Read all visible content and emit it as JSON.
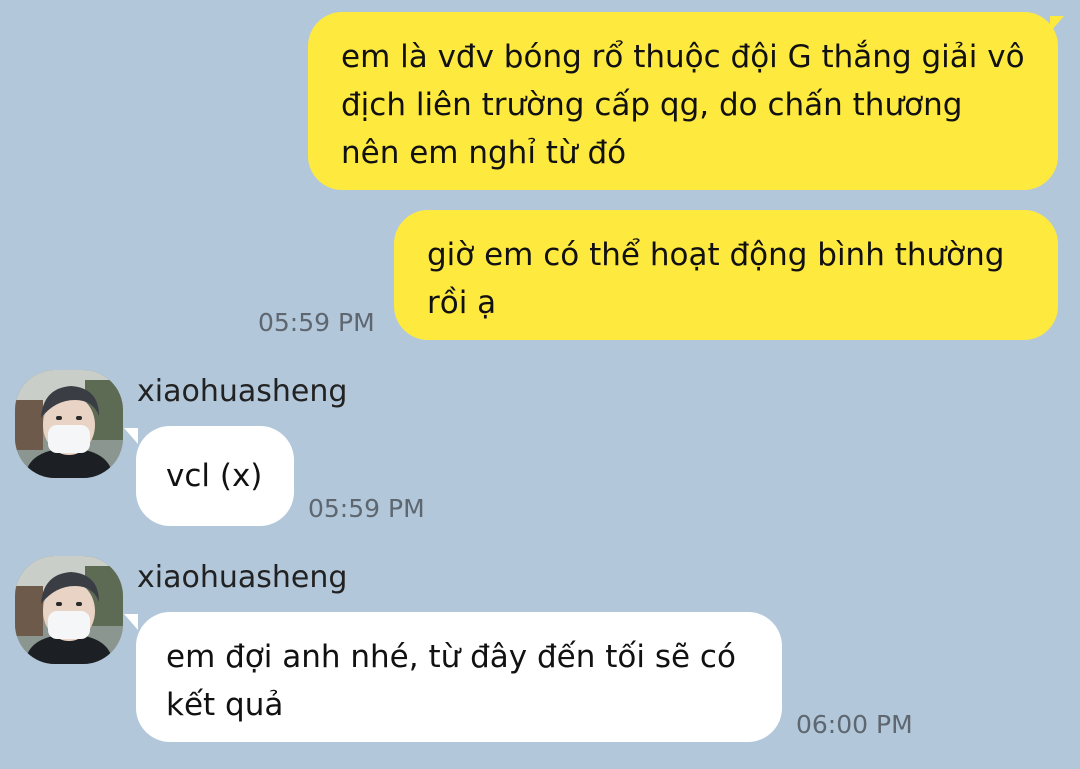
{
  "messages": {
    "m1": {
      "text": "em là vđv bóng rổ thuộc đội G thắng giải vô địch liên trường cấp qg, do chấn thương nên em nghỉ từ đó"
    },
    "m2": {
      "text": "giờ em có thể hoạt động bình thường rồi ạ",
      "time": "05:59 PM"
    },
    "m3": {
      "sender": "xiaohuasheng",
      "text": "vcl (x)",
      "time": "05:59 PM"
    },
    "m4": {
      "sender": "xiaohuasheng",
      "text": "em đợi anh nhé, từ đây đến tối sẽ có kết quả",
      "time": "06:00 PM"
    }
  },
  "colors": {
    "background": "#b2c7da",
    "outgoing_bubble": "#fee93f",
    "incoming_bubble": "#ffffff",
    "timestamp": "#5e6670"
  },
  "icons": {
    "avatar": "profile-photo-masked-person"
  }
}
